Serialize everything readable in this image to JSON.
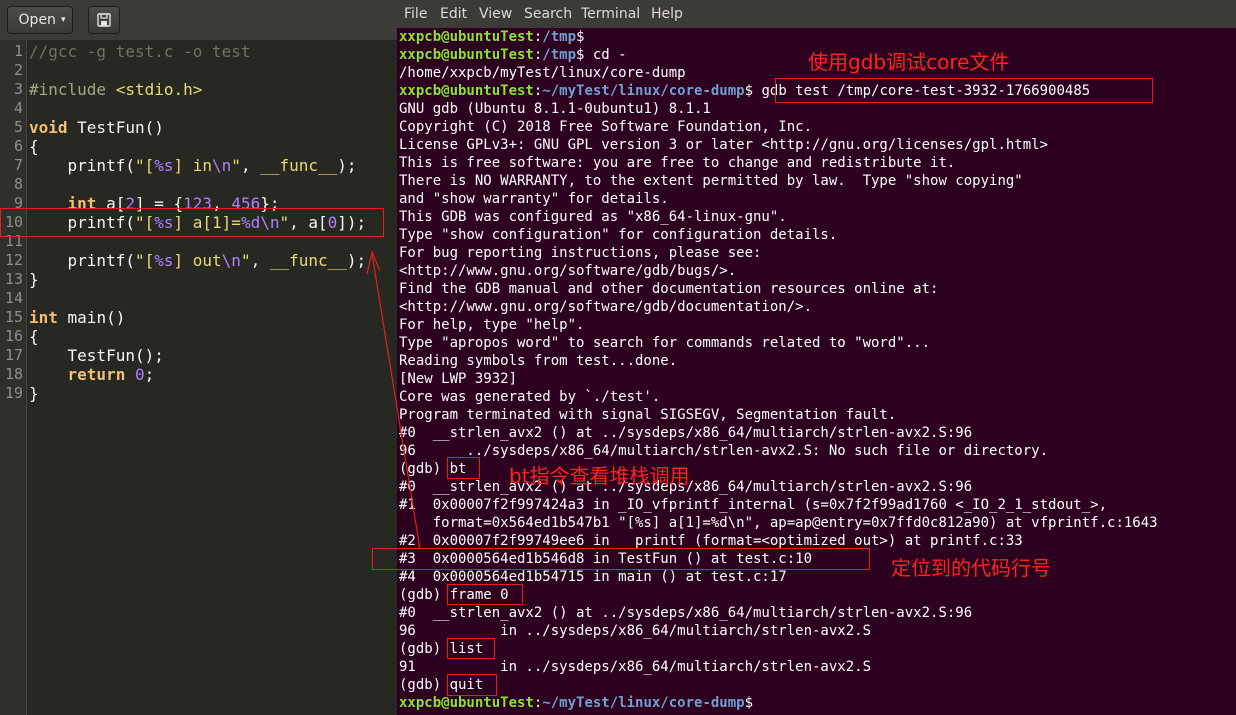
{
  "editor": {
    "toolbar": {
      "open_label": "Open",
      "open_caret": "▾",
      "save_icon": "save-icon"
    },
    "line_numbers": [
      "1",
      "2",
      "3",
      "4",
      "5",
      "6",
      "7",
      "8",
      "9",
      "10",
      "11",
      "12",
      "13",
      "14",
      "15",
      "16",
      "17",
      "18",
      "19"
    ],
    "code": {
      "l1": "//gcc -g test.c -o test",
      "l3_pp": "#include ",
      "l3_hdr": "<stdio.h>",
      "l5_kw": "void",
      "l5_rest": " TestFun()",
      "l6": "{",
      "l7_a": "    printf(",
      "l7_s1": "\"[",
      "l7_s2": "%s",
      "l7_s3": "] in",
      "l7_s4": "\\n",
      "l7_s5": "\"",
      "l7_b": ", ",
      "l7_fn": "__func__",
      "l7_c": ");",
      "l9_ind": "    ",
      "l9_kw": "int",
      "l9_a": " a[",
      "l9_n1": "2",
      "l9_b": "] = {",
      "l9_n2": "123",
      "l9_c": ", ",
      "l9_n3": "456",
      "l9_d": "};",
      "l10_a": "    printf(",
      "l10_s1": "\"[",
      "l10_s2": "%s",
      "l10_s3": "] a[1]=",
      "l10_s4": "%d",
      "l10_s5": "\\n",
      "l10_s6": "\"",
      "l10_b": ", a[",
      "l10_n": "0",
      "l10_c": "]);",
      "l12_a": "    printf(",
      "l12_s1": "\"[",
      "l12_s2": "%s",
      "l12_s3": "] out",
      "l12_s4": "\\n",
      "l12_s5": "\"",
      "l12_b": ", ",
      "l12_fn": "__func__",
      "l12_c": ");",
      "l13": "}",
      "l15_kw": "int",
      "l15_rest": " main()",
      "l16": "{",
      "l17": "    TestFun();",
      "l18_ind": "    ",
      "l18_kw": "return",
      "l18_sp": " ",
      "l18_n": "0",
      "l18_end": ";",
      "l19": "}"
    }
  },
  "terminal": {
    "menu": [
      "File",
      "Edit",
      "View",
      "Search",
      "Terminal",
      "Help"
    ],
    "prompt": {
      "user": "xxpcb@ubuntuTest",
      "colon": ":",
      "dollar": "$",
      "path_tmp": "/tmp",
      "path_core": "~/myTest/linux/core-dump"
    },
    "lines": {
      "t1_cmd": "",
      "t2_cmd": " cd -",
      "t3": "/home/xxpcb/myTest/linux/core-dump",
      "t4_cmd": " gdb test /tmp/core-test-3932-1766900485",
      "t5": "GNU gdb (Ubuntu 8.1.1-0ubuntu1) 8.1.1",
      "t6": "Copyright (C) 2018 Free Software Foundation, Inc.",
      "t7": "License GPLv3+: GNU GPL version 3 or later <http://gnu.org/licenses/gpl.html>",
      "t8": "This is free software: you are free to change and redistribute it.",
      "t9": "There is NO WARRANTY, to the extent permitted by law.  Type \"show copying\"",
      "t10": "and \"show warranty\" for details.",
      "t11": "This GDB was configured as \"x86_64-linux-gnu\".",
      "t12": "Type \"show configuration\" for configuration details.",
      "t13": "For bug reporting instructions, please see:",
      "t14": "<http://www.gnu.org/software/gdb/bugs/>.",
      "t15": "Find the GDB manual and other documentation resources online at:",
      "t16": "<http://www.gnu.org/software/gdb/documentation/>.",
      "t17": "For help, type \"help\".",
      "t18": "Type \"apropos word\" to search for commands related to \"word\"...",
      "t19": "Reading symbols from test...done.",
      "t20": "[New LWP 3932]",
      "t21": "Core was generated by `./test'.",
      "t22": "Program terminated with signal SIGSEGV, Segmentation fault.",
      "t23": "#0  __strlen_avx2 () at ../sysdeps/x86_64/multiarch/strlen-avx2.S:96",
      "t24": "96      ../sysdeps/x86_64/multiarch/strlen-avx2.S: No such file or directory.",
      "t25": "(gdb) bt",
      "t26": "#0  __strlen_avx2 () at ../sysdeps/x86_64/multiarch/strlen-avx2.S:96",
      "t27": "#1  0x00007f2f997424a3 in _IO_vfprintf_internal (s=0x7f2f99ad1760 <_IO_2_1_stdout_>,",
      "t28": "    format=0x564ed1b547b1 \"[%s] a[1]=%d\\n\", ap=ap@entry=0x7ffd0c812a90) at vfprintf.c:1643",
      "t29": "#2  0x00007f2f99749ee6 in __printf (format=<optimized out>) at printf.c:33",
      "t30": "#3  0x0000564ed1b546d8 in TestFun () at test.c:10",
      "t31": "#4  0x0000564ed1b54715 in main () at test.c:17",
      "t32": "(gdb) frame 0",
      "t33": "#0  __strlen_avx2 () at ../sysdeps/x86_64/multiarch/strlen-avx2.S:96",
      "t34": "96          in ../sysdeps/x86_64/multiarch/strlen-avx2.S",
      "t35": "(gdb) list",
      "t36": "91          in ../sysdeps/x86_64/multiarch/strlen-avx2.S",
      "t37": "(gdb) quit",
      "t38_cmd": ""
    }
  },
  "annotations": {
    "gdb_label": "使用gdb调试core文件",
    "bt_label": "bt指令查看堆栈调用",
    "locate_label": "定位到的代码行号"
  },
  "colors": {
    "annotation_red": "#e02020",
    "terminal_bg": "#2c001e",
    "editor_bg": "#272822",
    "prompt_green": "#8ae234",
    "prompt_blue": "#729fcf"
  }
}
